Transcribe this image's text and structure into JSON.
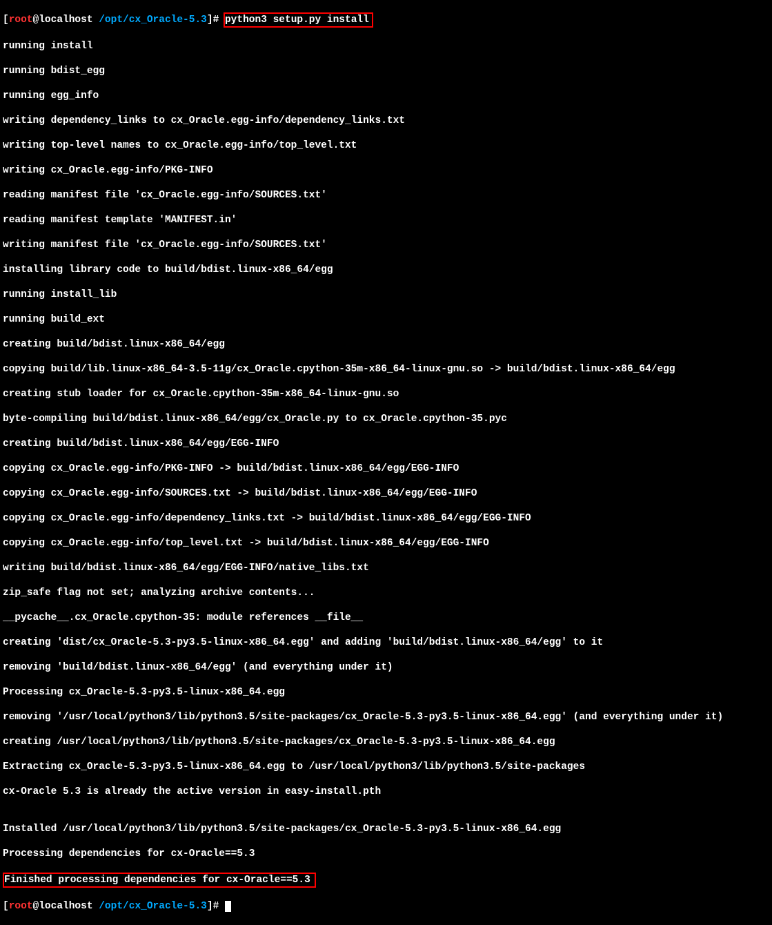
{
  "prompt1": {
    "bracket_open": "[",
    "user": "root",
    "at": "@",
    "host": "localhost ",
    "path": "/opt/cx_Oracle-5.3",
    "bracket_close": "]",
    "hash": "# ",
    "command": "python3 setup.py install"
  },
  "out": [
    "running install",
    "running bdist_egg",
    "running egg_info",
    "writing dependency_links to cx_Oracle.egg-info/dependency_links.txt",
    "writing top-level names to cx_Oracle.egg-info/top_level.txt",
    "writing cx_Oracle.egg-info/PKG-INFO",
    "reading manifest file 'cx_Oracle.egg-info/SOURCES.txt'",
    "reading manifest template 'MANIFEST.in'",
    "writing manifest file 'cx_Oracle.egg-info/SOURCES.txt'",
    "installing library code to build/bdist.linux-x86_64/egg",
    "running install_lib",
    "running build_ext",
    "creating build/bdist.linux-x86_64/egg",
    "copying build/lib.linux-x86_64-3.5-11g/cx_Oracle.cpython-35m-x86_64-linux-gnu.so -> build/bdist.linux-x86_64/egg",
    "creating stub loader for cx_Oracle.cpython-35m-x86_64-linux-gnu.so",
    "byte-compiling build/bdist.linux-x86_64/egg/cx_Oracle.py to cx_Oracle.cpython-35.pyc",
    "creating build/bdist.linux-x86_64/egg/EGG-INFO",
    "copying cx_Oracle.egg-info/PKG-INFO -> build/bdist.linux-x86_64/egg/EGG-INFO",
    "copying cx_Oracle.egg-info/SOURCES.txt -> build/bdist.linux-x86_64/egg/EGG-INFO",
    "copying cx_Oracle.egg-info/dependency_links.txt -> build/bdist.linux-x86_64/egg/EGG-INFO",
    "copying cx_Oracle.egg-info/top_level.txt -> build/bdist.linux-x86_64/egg/EGG-INFO",
    "writing build/bdist.linux-x86_64/egg/EGG-INFO/native_libs.txt",
    "zip_safe flag not set; analyzing archive contents...",
    "__pycache__.cx_Oracle.cpython-35: module references __file__",
    "creating 'dist/cx_Oracle-5.3-py3.5-linux-x86_64.egg' and adding 'build/bdist.linux-x86_64/egg' to it",
    "removing 'build/bdist.linux-x86_64/egg' (and everything under it)",
    "Processing cx_Oracle-5.3-py3.5-linux-x86_64.egg",
    "removing '/usr/local/python3/lib/python3.5/site-packages/cx_Oracle-5.3-py3.5-linux-x86_64.egg' (and everything under it)",
    "creating /usr/local/python3/lib/python3.5/site-packages/cx_Oracle-5.3-py3.5-linux-x86_64.egg",
    "Extracting cx_Oracle-5.3-py3.5-linux-x86_64.egg to /usr/local/python3/lib/python3.5/site-packages",
    "cx-Oracle 5.3 is already the active version in easy-install.pth",
    "",
    "Installed /usr/local/python3/lib/python3.5/site-packages/cx_Oracle-5.3-py3.5-linux-x86_64.egg",
    "Processing dependencies for cx-Oracle==5.3"
  ],
  "finished_line": "Finished processing dependencies for cx-Oracle==5.3",
  "prompt2": {
    "bracket_open": "[",
    "user": "root",
    "at": "@",
    "host": "localhost ",
    "path": "/opt/cx_Oracle-5.3",
    "bracket_close": "]",
    "hash": "# "
  }
}
